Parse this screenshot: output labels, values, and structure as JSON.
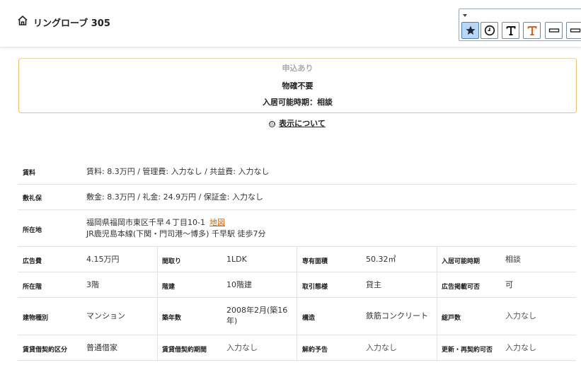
{
  "header": {
    "title": "リングローブ 305"
  },
  "toolbar": {
    "buttons": [
      "star-icon",
      "clock-icon",
      "text-icon",
      "text-orange-icon",
      "line-icon",
      "line-icon"
    ],
    "accent": "#e05a1a"
  },
  "notice": {
    "status": "申込あり",
    "line2": "物確不要",
    "line3": "入居可能時期：相談",
    "border_color": "#e8c070"
  },
  "about": {
    "icon": "ⓘ",
    "label": "表示について"
  },
  "details": {
    "rent": {
      "label": "賃料",
      "value": "賃料: 8.3万円 / 管理費: 入力なし / 共益費: 入力なし"
    },
    "deposit": {
      "label": "敷礼保",
      "value": "敷金: 8.3万円 / 礼金: 24.9万円 / 保証金: 入力なし"
    },
    "address": {
      "label": "所在地",
      "line1": "福岡県福岡市東区千早４丁目10-1",
      "map_link": "地図",
      "line2": "JR鹿児島本線(下関・門司港～博多) 千早駅 徒歩7分"
    },
    "grid": [
      [
        {
          "label": "広告費",
          "value": "4.15万円"
        },
        {
          "label": "間取り",
          "value": "1LDK"
        },
        {
          "label": "専有面積",
          "value": "50.32㎡"
        },
        {
          "label": "入居可能時期",
          "value": "相談"
        }
      ],
      [
        {
          "label": "所在階",
          "value": "3階"
        },
        {
          "label": "階建",
          "value": "10階建"
        },
        {
          "label": "取引態様",
          "value": "貸主"
        },
        {
          "label": "広告掲載可否",
          "value": "可"
        }
      ],
      [
        {
          "label": "建物種別",
          "value": "マンション"
        },
        {
          "label": "築年数",
          "value": "2008年2月(築16年)"
        },
        {
          "label": "構造",
          "value": "鉄筋コンクリート"
        },
        {
          "label": "総戸数",
          "value": "入力なし"
        }
      ],
      [
        {
          "label": "賃貸借契約区分",
          "value": "普通借家"
        },
        {
          "label": "賃貸借契約期間",
          "value": "入力なし"
        },
        {
          "label": "解約予告",
          "value": "入力なし"
        },
        {
          "label": "更新・再契約可否",
          "value": "入力なし"
        }
      ]
    ]
  }
}
